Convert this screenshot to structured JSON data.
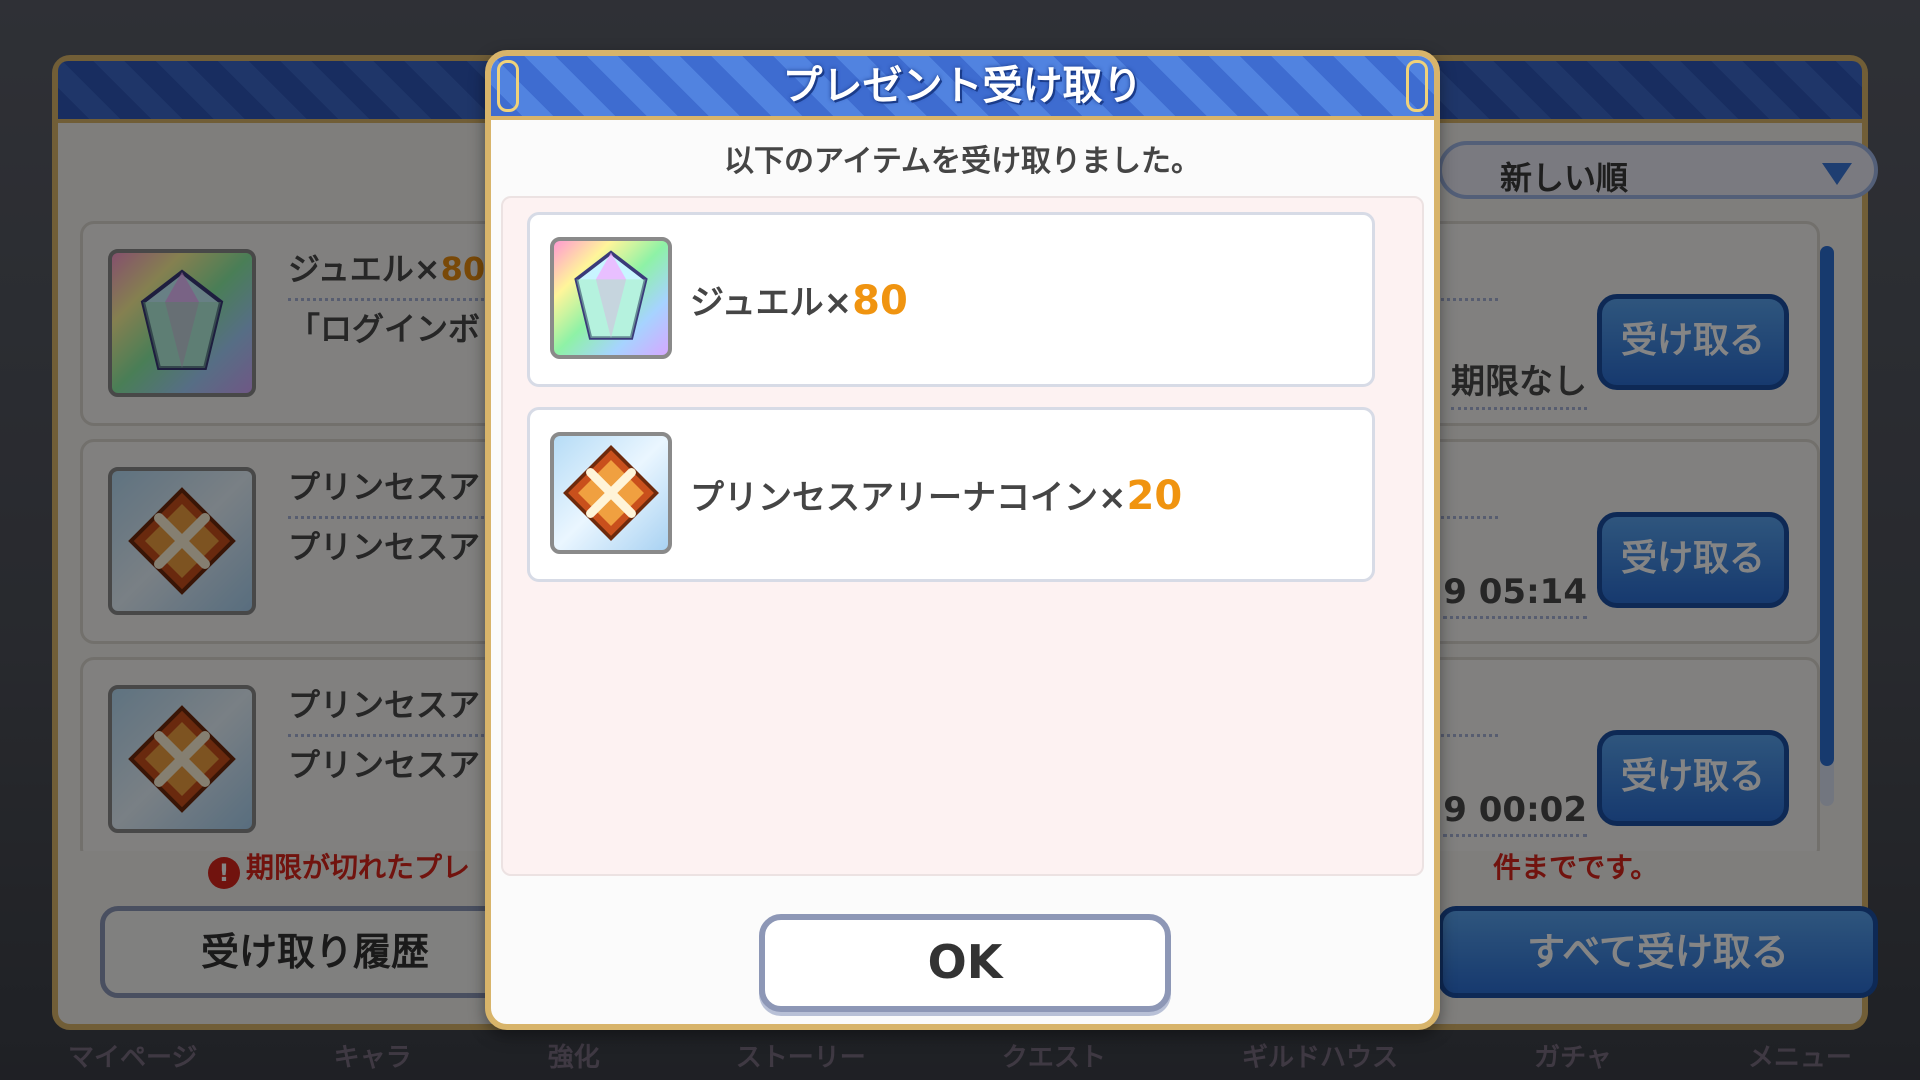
{
  "background": {
    "sort_label": "新しい順",
    "rows": [
      {
        "title": "ジュエル×",
        "amount": "80",
        "sub": "「ログインボ",
        "date": "期限なし",
        "icon": "jewel-icon"
      },
      {
        "title": "プリンセスア",
        "amount": "",
        "sub": "プリンセスア",
        "date": "9 05:14",
        "icon": "arena-coin-icon"
      },
      {
        "title": "プリンセスア",
        "amount": "",
        "sub": "プリンセスア",
        "date": "9 00:02",
        "icon": "arena-coin-icon"
      }
    ],
    "receive_label": "受け取る",
    "warning_left": "期限が切れたプレ",
    "warning_right": "件までです。",
    "history_label": "受け取り履歴",
    "receive_all_label": "すべて受け取る",
    "nav": [
      "マイページ",
      "キャラ",
      "強化",
      "ストーリー",
      "クエスト",
      "ギルドハウス",
      "ガチャ",
      "メニュー"
    ]
  },
  "dialog": {
    "title": "プレゼント受け取り",
    "message": "以下のアイテムを受け取りました。",
    "items": [
      {
        "name": "ジュエル×",
        "amount": "80",
        "icon": "jewel-icon"
      },
      {
        "name": "プリンセスアリーナコイン×",
        "amount": "20",
        "icon": "arena-coin-icon"
      }
    ],
    "ok_label": "OK"
  },
  "colors": {
    "header_blue": "#3e6cd0",
    "gold_border": "#d8b46a",
    "amount_orange": "#f09410",
    "button_blue": "#2c6fd4",
    "warning_red": "#d9261b"
  }
}
